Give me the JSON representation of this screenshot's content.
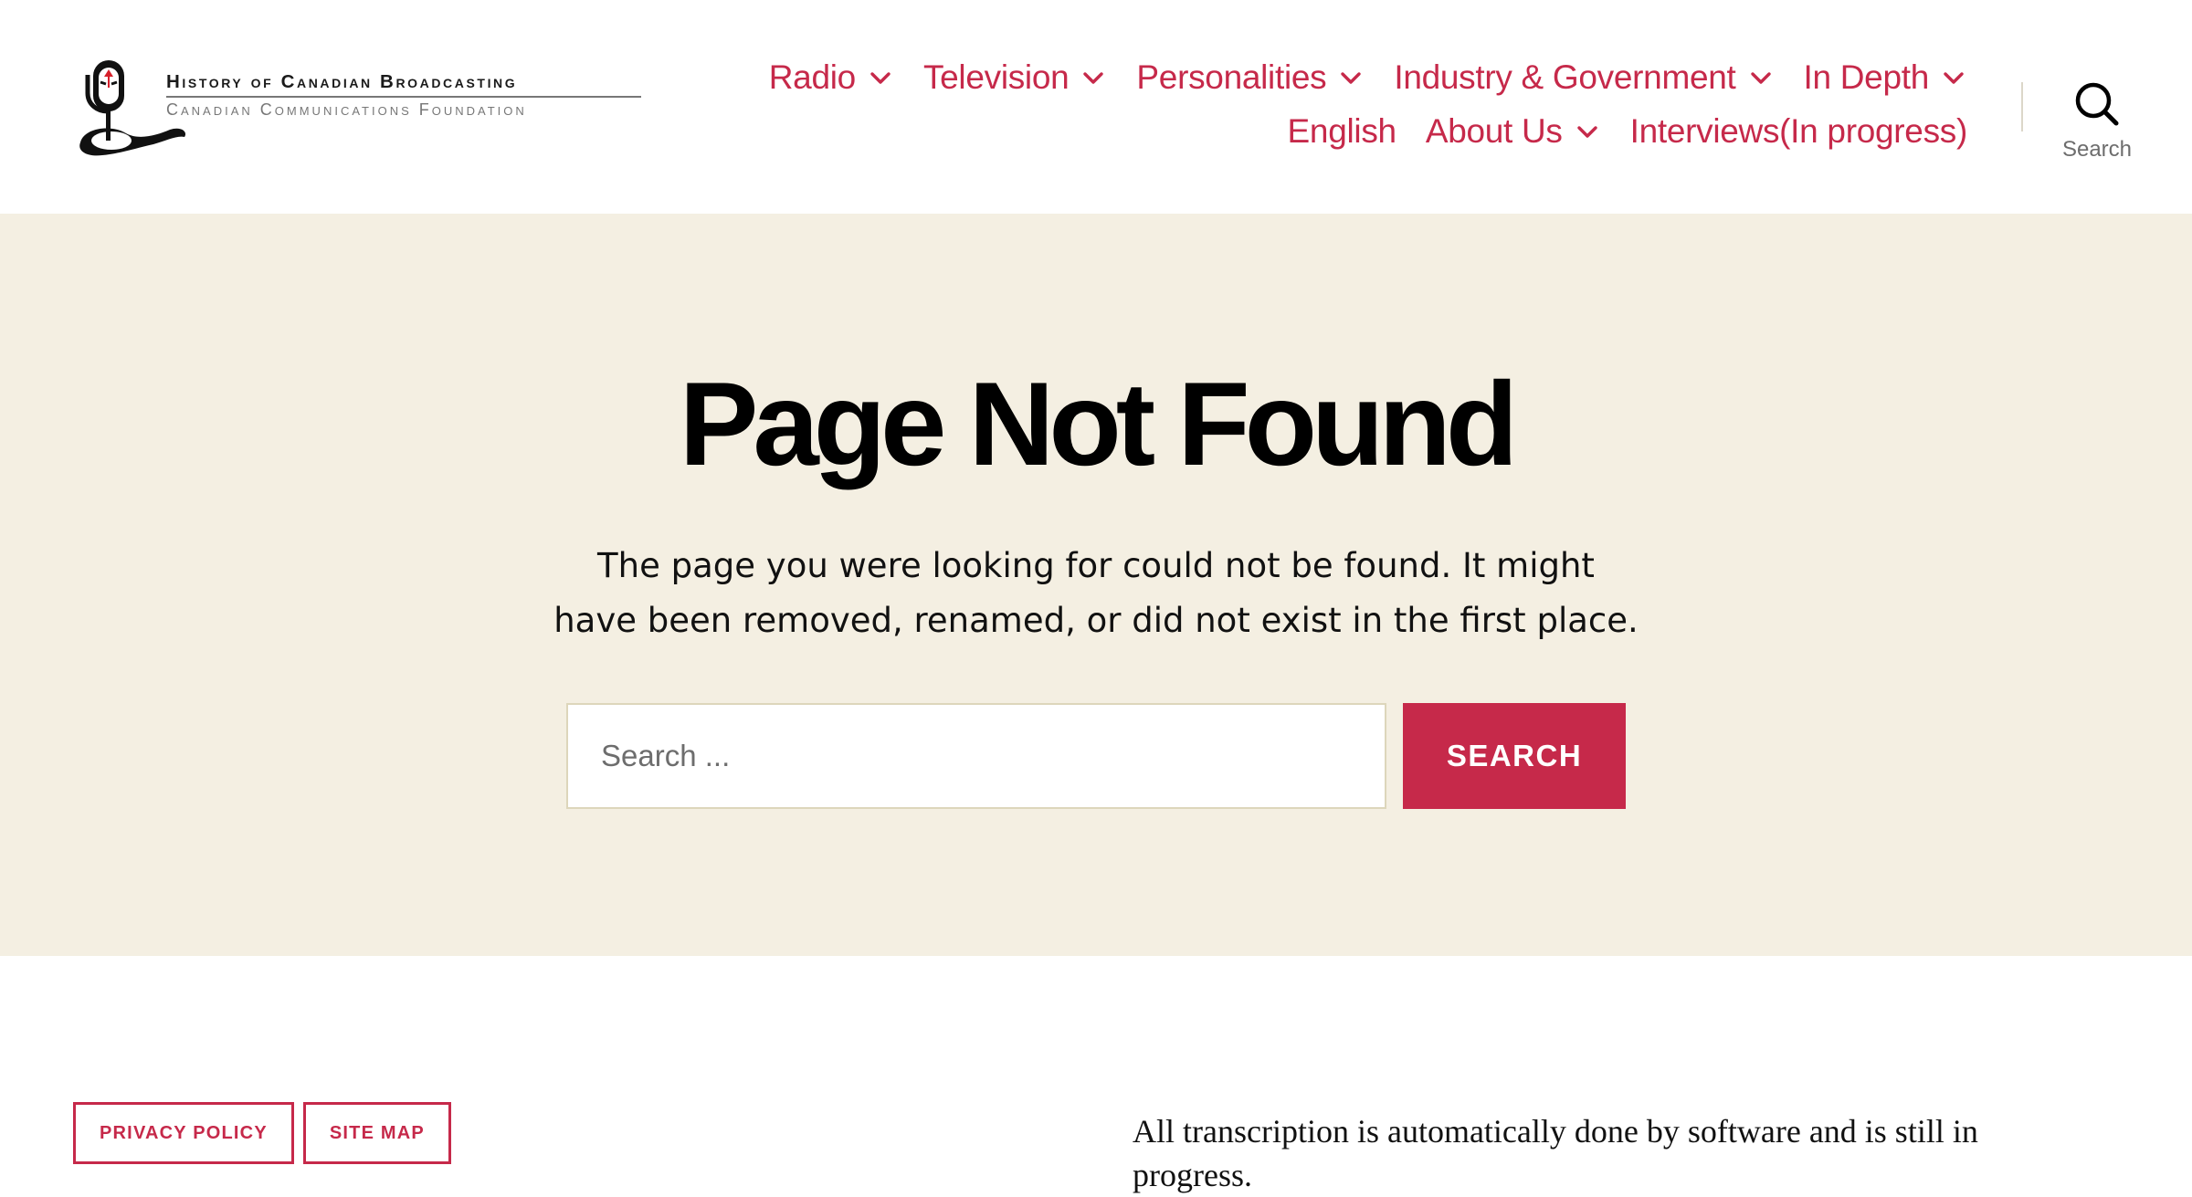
{
  "header": {
    "logo_title": "History of Canadian Broadcasting",
    "logo_subtitle": "Canadian Communications Foundation",
    "nav_row1": [
      {
        "label": "Radio",
        "has_submenu": true
      },
      {
        "label": "Television",
        "has_submenu": true
      },
      {
        "label": "Personalities",
        "has_submenu": true
      },
      {
        "label": "Industry & Government",
        "has_submenu": true
      },
      {
        "label": "In Depth",
        "has_submenu": true
      }
    ],
    "nav_row2": [
      {
        "label": "English",
        "has_submenu": false
      },
      {
        "label": "About Us",
        "has_submenu": true
      },
      {
        "label": "Interviews(In progress)",
        "has_submenu": false
      }
    ],
    "search_toggle_label": "Search"
  },
  "main": {
    "title": "Page Not Found",
    "intro_line1": "The page you were looking for could not be found. It might",
    "intro_line2": "have been removed, renamed, or did not exist in the first place.",
    "search_placeholder": "Search ...",
    "search_button": "Search"
  },
  "footer": {
    "links": [
      "Privacy Policy",
      "Site Map"
    ],
    "note": "All transcription is automatically done by software and is still in progress."
  },
  "colors": {
    "accent": "#c6294a",
    "band_background": "#f4efe2",
    "text": "#000000",
    "muted": "#6d6d6d"
  },
  "icons": {
    "logo": "microphone-logo-icon",
    "submenu": "chevron-down-icon",
    "search": "search-icon"
  }
}
